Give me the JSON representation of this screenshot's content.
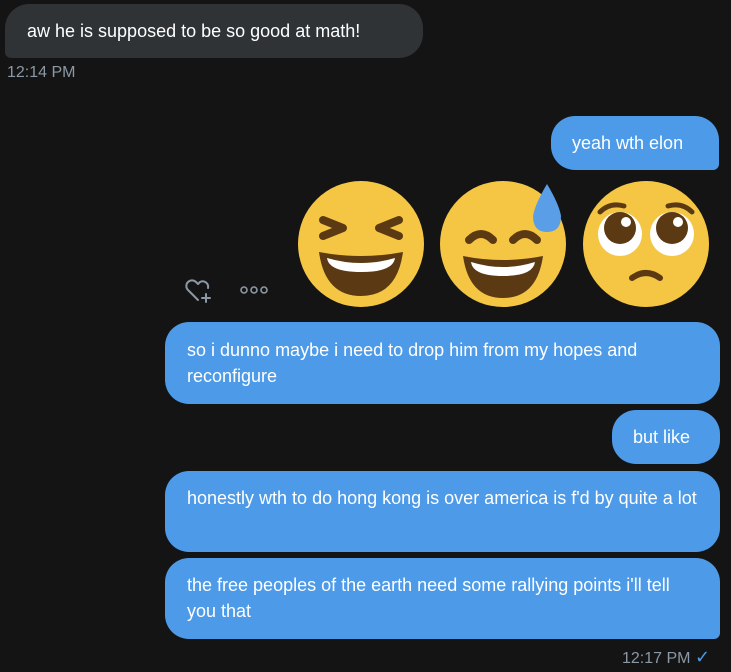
{
  "messages": {
    "m1": "aw he is supposed to be so good at math!",
    "m2": "yeah wth elon",
    "m3": "so i dunno maybe i need to drop him from my hopes and reconfigure",
    "m4": "but like",
    "m5": "honestly wth to do hong kong is over america is f'd by quite a lot",
    "m6": "the free peoples of the earth need some rallying points i'll tell you that"
  },
  "timestamps": {
    "t1": "12:14 PM",
    "t2": "12:17 PM"
  },
  "read_check": "✓",
  "emojis": [
    "grinning-squinting-face",
    "grinning-face-with-sweat",
    "pleading-face"
  ],
  "actions": {
    "react_icon": "heart-plus-icon",
    "more_icon": "more-dots-icon"
  },
  "colors": {
    "background": "#141414",
    "received_bubble": "#2f3336",
    "sent_bubble": "#4c9ae8",
    "emoji_yellow": "#f5c644"
  }
}
